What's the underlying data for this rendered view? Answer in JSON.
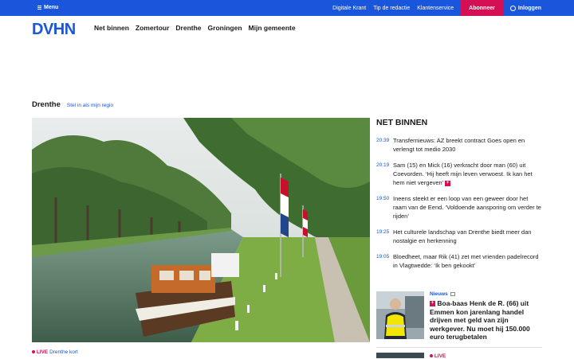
{
  "topbar": {
    "menu_label": "Menu",
    "links": [
      "Digitale Krant",
      "Tip de redactie",
      "Klantenservice"
    ],
    "subscribe_label": "Abonneer",
    "login_label": "Inloggen"
  },
  "logo": "DVHN",
  "nav": [
    "Net binnen",
    "Zomertour",
    "Drenthe",
    "Groningen",
    "Mijn gemeente"
  ],
  "region": {
    "title": "Drenthe",
    "set_label": "Stel in als mijn regio"
  },
  "hero": {
    "live_label": "LIVE",
    "caption": "Drenthe kort"
  },
  "net_binnen": {
    "title": "NET BINNEN",
    "items": [
      {
        "time": "20:39",
        "text": "Transfernieuws: AZ breekt contract Goes open en verlengt tot medio 2030"
      },
      {
        "time": "20:19",
        "text": "Sam (15) en Mick (16) verkracht door man (60) uit Coevorden. ‘Hij heeft mijn leven verwoest. Ik kan het hem niet vergeven’"
      },
      {
        "time": "19:50",
        "text": "Ineens steekt er een loop van een geweer door het raam van de Eend. ‘Voldoende aansporing om verder te rijden’"
      },
      {
        "time": "19:25",
        "text": "Het culturele landschap van Drenthe biedt meer dan nostalgie en herkenning"
      },
      {
        "time": "19:05",
        "text": "Bloedheet, maar Rik (41) zet met vrienden padelrecord in Vlagtwedde: ‘Ik ben gekookt’"
      }
    ]
  },
  "card": {
    "label": "Nieuws",
    "headline": "Boa-baas Henk de R. (66) uit Emmen kon jarenlang handel drijven met geld van zijn werkgever. Nu moet hij 150.000 euro terugbetalen"
  },
  "next_live_label": "LIVE",
  "colors": {
    "brand": "#1a56db",
    "accent": "#d40f54"
  }
}
